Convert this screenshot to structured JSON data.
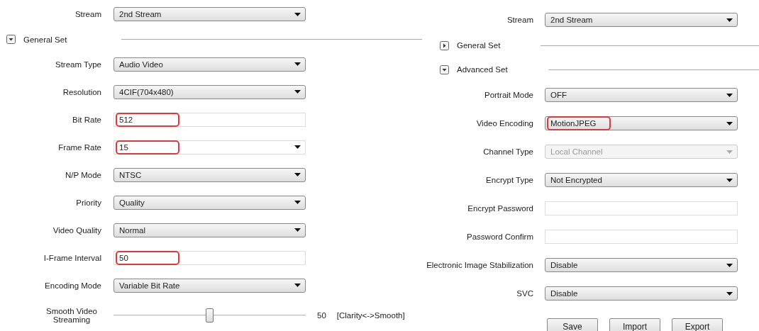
{
  "panels": [
    {
      "rows": [
        {
          "kind": "select",
          "label": "Stream",
          "value": "2nd Stream"
        },
        {
          "kind": "section",
          "label": "General Set",
          "expanded": true
        },
        {
          "kind": "select",
          "label": "Stream Type",
          "value": "Audio Video"
        },
        {
          "kind": "select",
          "label": "Resolution",
          "value": "4CIF(704x480)"
        },
        {
          "kind": "input",
          "label": "Bit Rate",
          "value": "512",
          "highlighted": true
        },
        {
          "kind": "combo",
          "label": "Frame Rate",
          "value": "15",
          "highlighted": true
        },
        {
          "kind": "select",
          "label": "N/P Mode",
          "value": "NTSC"
        },
        {
          "kind": "select",
          "label": "Priority",
          "value": "Quality"
        },
        {
          "kind": "select",
          "label": "Video Quality",
          "value": "Normal"
        },
        {
          "kind": "input",
          "label": "I-Frame Interval",
          "value": "50",
          "highlighted": true
        },
        {
          "kind": "select",
          "label": "Encoding Mode",
          "value": "Variable Bit Rate"
        },
        {
          "kind": "slider",
          "label": "Smooth Video Streaming",
          "level": 0.5,
          "reading": "50",
          "hint": "[Clarity<->Smooth]"
        }
      ]
    },
    {
      "rows": [
        {
          "kind": "select",
          "label": "Stream",
          "value": "2nd Stream"
        },
        {
          "kind": "section",
          "label": "General Set",
          "expanded": false
        },
        {
          "kind": "section",
          "label": "Advanced Set",
          "expanded": true
        },
        {
          "kind": "select",
          "label": "Portrait Mode",
          "value": "OFF"
        },
        {
          "kind": "select",
          "label": "Video Encoding",
          "value": "MotionJPEG",
          "highlighted": true
        },
        {
          "kind": "select",
          "label": "Channel Type",
          "value": "Local Channel",
          "disabled": true
        },
        {
          "kind": "select",
          "label": "Encrypt Type",
          "value": "Not Encrypted"
        },
        {
          "kind": "input",
          "label": "Encrypt Password"
        },
        {
          "kind": "input",
          "label": "Password Confirm"
        },
        {
          "kind": "select",
          "label": "Electronic Image Stabilization",
          "value": "Disable"
        },
        {
          "kind": "select",
          "label": "SVC",
          "value": "Disable"
        }
      ],
      "buttons": [
        "Save",
        "Import",
        "Export"
      ]
    }
  ]
}
